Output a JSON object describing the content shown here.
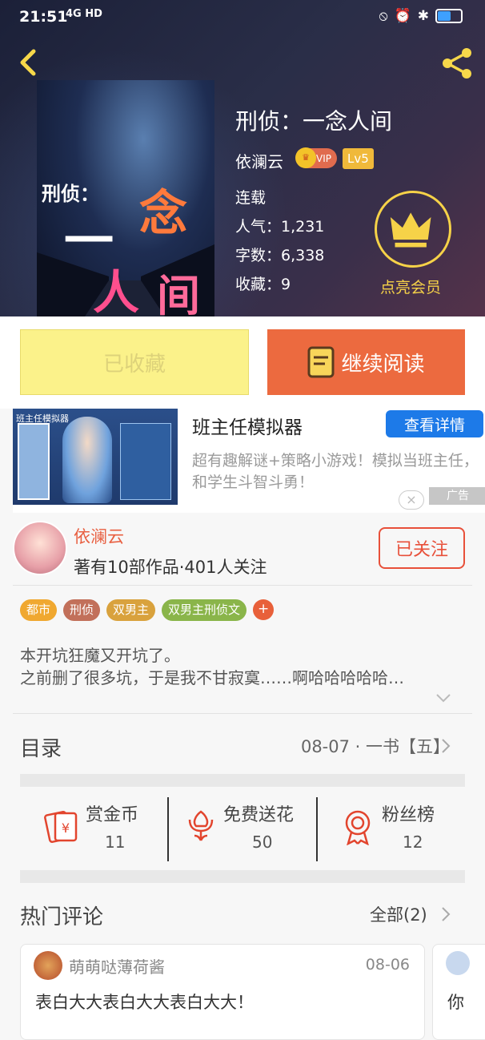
{
  "status_bar": {
    "time": "21:51",
    "network": "4G HD",
    "battery_level": 0.5
  },
  "book": {
    "title": "刑侦：一念人间",
    "author": "依澜云",
    "vip_badge": "VIP",
    "level": "Lv5",
    "status": "连载",
    "popularity": "人气：1,231",
    "word_count": "字数：6,338",
    "favorites": "收藏：9",
    "cover_text": [
      "刑侦：",
      "一",
      "念",
      "人",
      "间"
    ]
  },
  "member": {
    "label": "点亮会员"
  },
  "actions": {
    "collected_label": "已收藏",
    "read_label": "继续阅读"
  },
  "ad": {
    "image_title": "班主任模拟器",
    "title": "班主任模拟器",
    "button": "查看详情",
    "description": "超有趣解谜+策略小游戏！模拟当班主任，和学生斗智斗勇！",
    "tag": "广告",
    "close": "×"
  },
  "author_card": {
    "name": "依澜云",
    "info": "著有10部作品·401人关注",
    "follow_button": "已关注"
  },
  "tags": [
    {
      "label": "都市",
      "color": "#f0a830"
    },
    {
      "label": "刑侦",
      "color": "#c2705a"
    },
    {
      "label": "双男主",
      "color": "#d9a23d"
    },
    {
      "label": "双男主刑侦文",
      "color": "#8ab54a"
    }
  ],
  "tag_add": "+",
  "intro": {
    "line1": "本开坑狂魔又开坑了。",
    "line2": "之前删了很多坑，于是我不甘寂寞……啊哈哈哈哈哈…"
  },
  "toc": {
    "label": "目录",
    "latest": "08-07 · 一书【五】"
  },
  "rewards": [
    {
      "label": "赏金币",
      "count": "11",
      "icon": "red-envelope-icon"
    },
    {
      "label": "免费送花",
      "count": "50",
      "icon": "flower-icon"
    },
    {
      "label": "粉丝榜",
      "count": "12",
      "icon": "medal-icon"
    }
  ],
  "hot_comments": {
    "label": "热门评论",
    "all": "全部(2)",
    "items": [
      {
        "user": "萌萌哒薄荷酱",
        "date": "08-06",
        "text": "表白大大表白大大表白大大！"
      },
      {
        "user": "",
        "date": "",
        "text": "你"
      }
    ]
  },
  "colors": {
    "accent": "#ec6a3f",
    "collect_bg": "#fbf28a",
    "gold": "#f6d248",
    "ad_button": "#1d7ae8"
  }
}
